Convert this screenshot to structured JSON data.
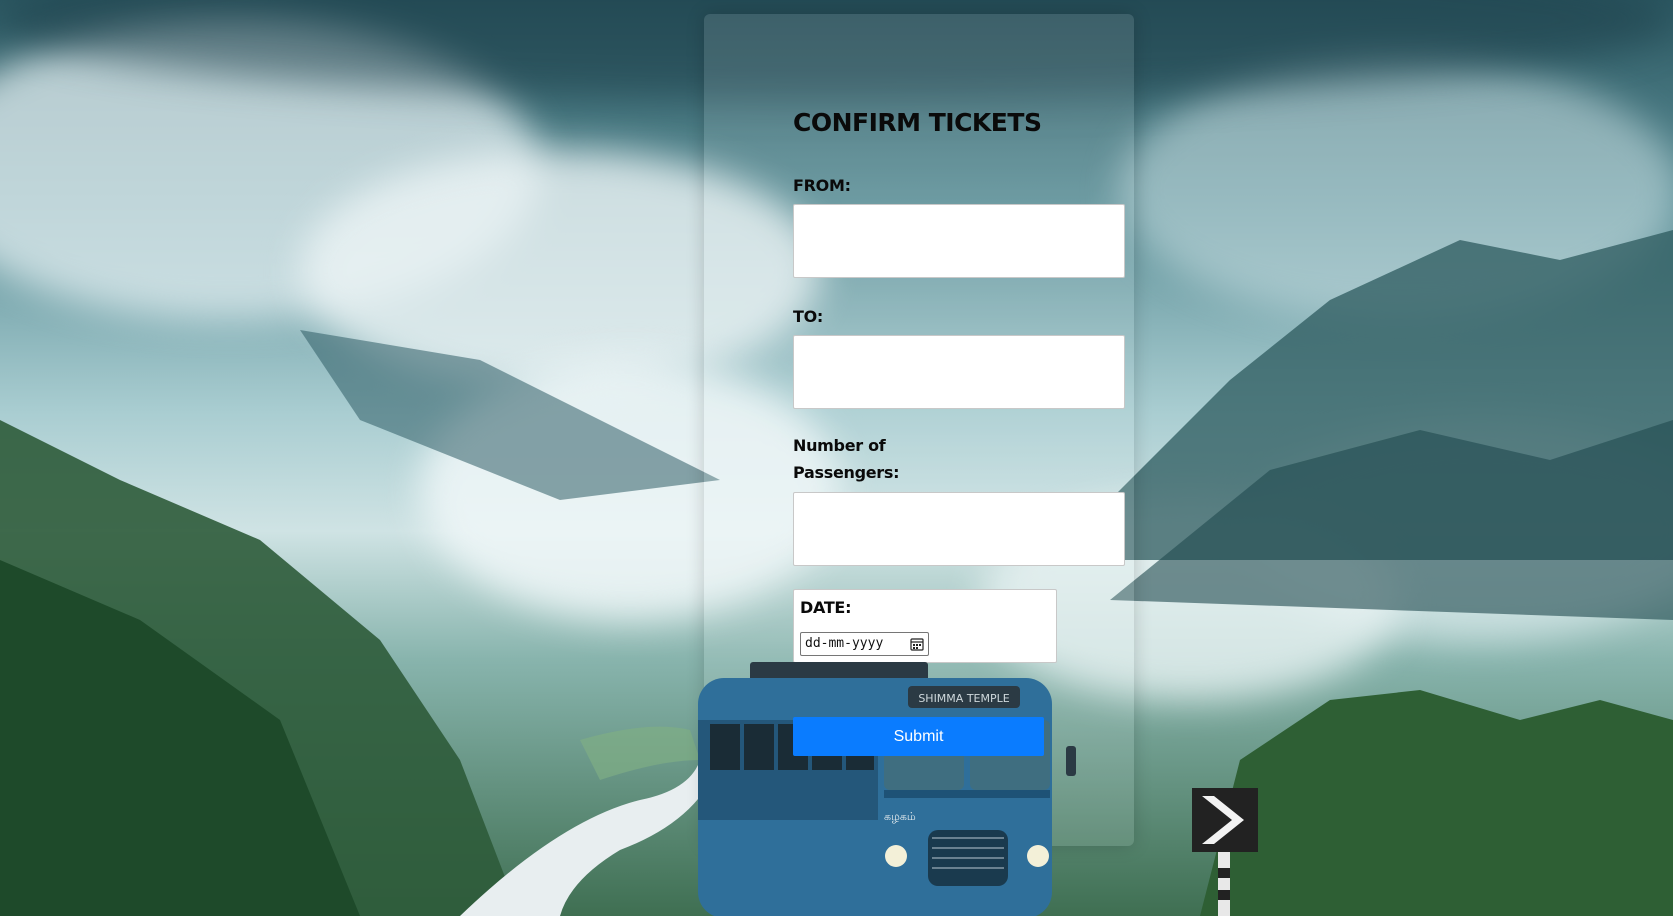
{
  "form": {
    "title": "CONFIRM TICKETS",
    "from_label": "FROM:",
    "to_label": "TO:",
    "passengers_label": "Number of Passengers:",
    "date_label": "DATE:",
    "date_placeholder": "dd-mm-yyyy",
    "submit_label": "Submit"
  },
  "bus": {
    "destination_sign": "SHIMMA TEMPLE",
    "front_text": "கழகம்"
  },
  "colors": {
    "submit_button": "#0a7cff",
    "bus_body": "#2f6f9a"
  },
  "icons": {
    "date_picker": "calendar-icon"
  }
}
